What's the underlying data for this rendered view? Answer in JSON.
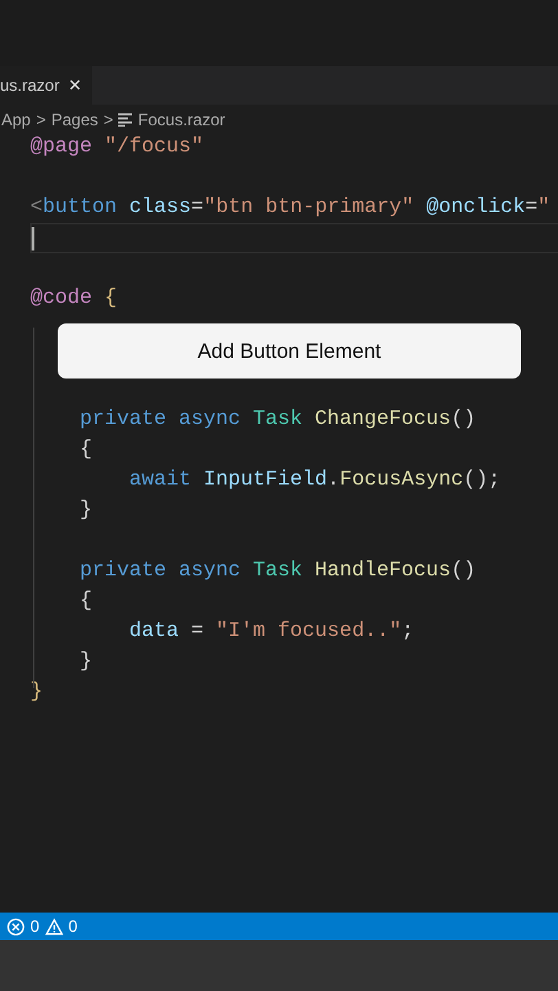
{
  "tab": {
    "label": "us.razor",
    "close": "✕",
    "selected": true
  },
  "breadcrumbs": [
    {
      "kind": "text",
      "label": "App"
    },
    {
      "kind": "sep",
      "label": ">"
    },
    {
      "kind": "text",
      "label": "Pages"
    },
    {
      "kind": "sep",
      "label": ">"
    },
    {
      "kind": "file",
      "label": "Focus.razor"
    }
  ],
  "lines": [
    {
      "kind": "code",
      "tokens": [
        {
          "kind": "directive",
          "text": "@page"
        },
        {
          "kind": "string",
          "text": " \"/focus\""
        }
      ]
    },
    {
      "kind": "blank"
    },
    {
      "kind": "code",
      "tokens": [
        {
          "kind": "tag",
          "text": "<"
        },
        {
          "kind": "keyword",
          "text": "button"
        },
        {
          "kind": "attr",
          "text": " class"
        },
        {
          "kind": "plain",
          "text": "="
        },
        {
          "kind": "string",
          "text": "\"btn btn-primary\""
        },
        {
          "kind": "attr",
          "text": " @onclick"
        },
        {
          "kind": "plain",
          "text": "="
        },
        {
          "kind": "string",
          "text": "\""
        }
      ]
    },
    {
      "kind": "cursor"
    },
    {
      "kind": "blank"
    },
    {
      "kind": "code",
      "tokens": [
        {
          "kind": "directive",
          "text": "@code"
        },
        {
          "kind": "bracket",
          "text": " {"
        }
      ]
    },
    {
      "kind": "blank"
    },
    {
      "kind": "blank"
    },
    {
      "kind": "blank"
    },
    {
      "kind": "code",
      "tokens": [
        {
          "kind": "keyword",
          "text": "    private async "
        },
        {
          "kind": "type",
          "text": "Task "
        },
        {
          "kind": "func",
          "text": "ChangeFocus"
        },
        {
          "kind": "plain",
          "text": "()"
        }
      ]
    },
    {
      "kind": "code",
      "tokens": [
        {
          "kind": "plain",
          "text": "    {"
        }
      ]
    },
    {
      "kind": "code",
      "tokens": [
        {
          "kind": "keyword",
          "text": "        await "
        },
        {
          "kind": "var",
          "text": "InputField"
        },
        {
          "kind": "plain",
          "text": "."
        },
        {
          "kind": "func",
          "text": "FocusAsync"
        },
        {
          "kind": "plain",
          "text": "();"
        }
      ]
    },
    {
      "kind": "code",
      "tokens": [
        {
          "kind": "plain",
          "text": "    }"
        }
      ]
    },
    {
      "kind": "blank"
    },
    {
      "kind": "code",
      "tokens": [
        {
          "kind": "keyword",
          "text": "    private async "
        },
        {
          "kind": "type",
          "text": "Task "
        },
        {
          "kind": "func",
          "text": "HandleFocus"
        },
        {
          "kind": "plain",
          "text": "()"
        }
      ]
    },
    {
      "kind": "code",
      "tokens": [
        {
          "kind": "plain",
          "text": "    {"
        }
      ]
    },
    {
      "kind": "code",
      "tokens": [
        {
          "kind": "var",
          "text": "        data"
        },
        {
          "kind": "plain",
          "text": " = "
        },
        {
          "kind": "string",
          "text": "\"I'm focused..\""
        },
        {
          "kind": "plain",
          "text": ";"
        }
      ]
    },
    {
      "kind": "code",
      "tokens": [
        {
          "kind": "plain",
          "text": "    }"
        }
      ]
    },
    {
      "kind": "code",
      "tokens": [
        {
          "kind": "bracket",
          "text": "}"
        }
      ]
    }
  ],
  "caption": "Add Button Element",
  "status_bar": {
    "errors": "0",
    "warnings": "0"
  }
}
